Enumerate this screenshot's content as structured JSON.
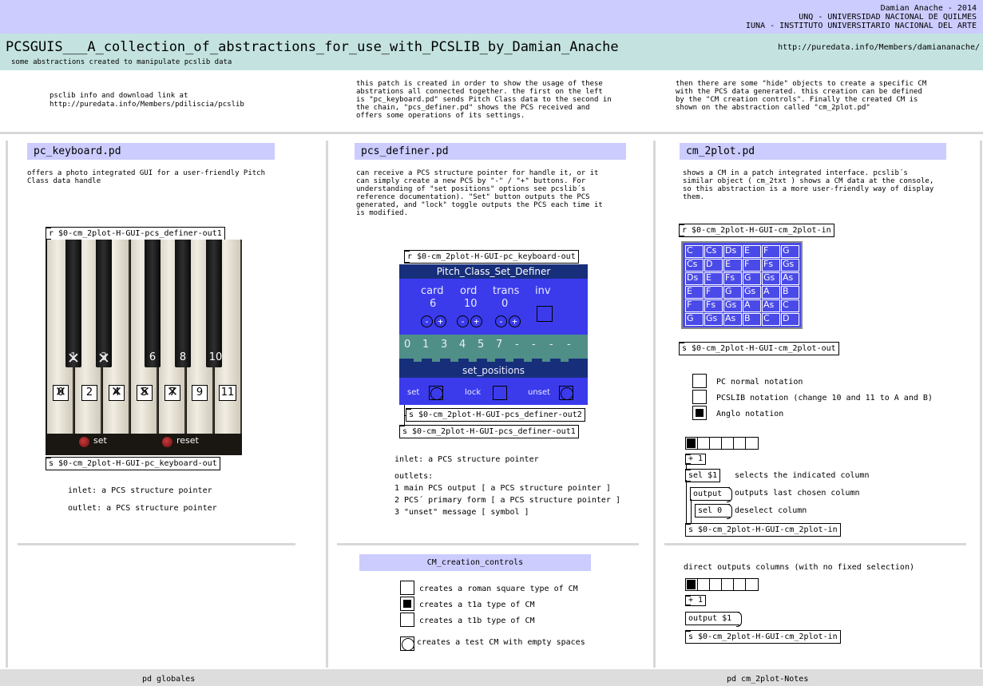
{
  "header": {
    "title": "PCSGUIS___A_collection_of_abstractions_for_use_with_PCSLIB_by_Damian_Anache",
    "subtitle": "some abstractions created to manipulate pcslib data",
    "url": "http://puredata.info/Members/damiananache/",
    "credits_line1": "Damian Anache - 2014",
    "credits_line2": "UNQ - UNIVERSIDAD NACIONAL DE QUILMES",
    "credits_line3": "IUNA - INSTITUTO UNIVERSITARIO NACIONAL DEL ARTE"
  },
  "intro": {
    "col1": "psclib info and download link at\nhttp://puredata.info/Members/pdiliscia/pcslib",
    "col2": "this patch is created in order to show the usage of these\nabstrations all connected together. the first on the left\nis \"pc_keyboard.pd\" sends Pitch Class data to the second in\nthe chain, \"pcs_definer.pd\" shows the PCS received and\noffers some operations of its settings.",
    "col3": "then there are some \"hide\" objects to create a specific CM\nwith the PCS data generated. this creation can be defined\nby the \"CM creation controls\". Finally the created CM is\nshown on the abstraction called \"cm_2plot.pd\""
  },
  "pc_keyboard": {
    "title": "pc_keyboard.pd",
    "desc": "offers a photo integrated GUI for a user-friendly Pitch\nClass data handle",
    "receive": "r $0-cm_2plot-H-GUI-pcs_definer-out1",
    "send": "s $0-cm_2plot-H-GUI-pc_keyboard-out",
    "black_numbers": [
      "1",
      "3",
      "6",
      "8",
      "10"
    ],
    "white_numbers": [
      "0",
      "2",
      "4",
      "5",
      "7",
      "9",
      "11"
    ],
    "set_label": "set",
    "reset_label": "reset",
    "inlet": "inlet: a PCS structure pointer",
    "outlet": "outlet: a PCS structure pointer"
  },
  "pcs_definer": {
    "title": "pcs_definer.pd",
    "desc": "can receive a PCS structure pointer for handle it, or it\ncan simply create a new PCS by \"-\" / \"+\" buttons. For\nunderstanding of \"set positions\" options see pcslib´s\nreference documentation). \"Set\" button outputs the PCS\ngenerated, and \"lock\" toggle outputs the PCS each time it\nis modified.",
    "receive": "r $0-cm_2plot-H-GUI-pc_keyboard-out",
    "gui_title": "Pitch_Class_Set_Definer",
    "card_label": "card",
    "ord_label": "ord",
    "trans_label": "trans",
    "inv_label": "inv",
    "card_value": "6",
    "ord_value": "10",
    "trans_value": "0",
    "minus": "-",
    "plus": "+",
    "positions": [
      "0",
      "1",
      "3",
      "4",
      "5",
      "7",
      "-",
      "-",
      "-",
      "-"
    ],
    "set_positions_label": "set_positions",
    "set_label": "set",
    "lock_label": "lock",
    "unset_label": "unset",
    "send2": "s $0-cm_2plot-H-GUI-pcs_definer-out2",
    "send1": "s $0-cm_2plot-H-GUI-pcs_definer-out1",
    "inlet": "inlet: a PCS structure pointer",
    "outlets_label": "outlets:",
    "outlet1": "1 main PCS output [ a PCS structure pointer ]",
    "outlet2": "2 PCS´ primary form [ a PCS structure pointer ]",
    "outlet3": "3 \"unset\" message [ symbol ]"
  },
  "cm_creation": {
    "title": "CM_creation_controls",
    "opt1": "creates a roman square type of CM",
    "opt2": "creates a t1a type of CM",
    "opt3": "creates a t1b type of CM",
    "opt4": "creates a test CM with empty spaces"
  },
  "cm_2plot": {
    "title": "cm_2plot.pd",
    "desc": "shows a CM in a patch integrated interface. pcslib´s\nsimilar object ( cm_2txt ) shows a CM data at the console,\nso this abstraction is a more user-friendly way of display\nthem.",
    "receive": "r $0-cm_2plot-H-GUI-cm_2plot-in",
    "send_out": "s $0-cm_2plot-H-GUI-cm_2plot-out",
    "grid": [
      [
        "C",
        "Cs",
        "Ds",
        "E",
        "F",
        "G"
      ],
      [
        "Cs",
        "D",
        "E",
        "F",
        "Fs",
        "Gs"
      ],
      [
        "Ds",
        "E",
        "Fs",
        "G",
        "Gs",
        "As"
      ],
      [
        "E",
        "F",
        "G",
        "Gs",
        "A",
        "B"
      ],
      [
        "F",
        "Fs",
        "Gs",
        "A",
        "As",
        "C"
      ],
      [
        "G",
        "Gs",
        "As",
        "B",
        "C",
        "D"
      ]
    ],
    "notation1": "PC normal notation",
    "notation2": "PCSLIB notation (change 10 and 11 to A and B)",
    "notation3": "Anglo notation",
    "plus1": "+ 1",
    "sel1": "sel $1",
    "sel1_comment": "selects the indicated column",
    "output_msg": "output",
    "output_comment": "outputs last chosen column",
    "sel0": "sel 0",
    "sel0_comment": "deselect column",
    "send_in": "s $0-cm_2plot-H-GUI-cm_2plot-in",
    "direct_comment": "direct outputs columns (with no fixed selection)",
    "plus1b": "+ 1",
    "output1_msg": "output $1",
    "send_in2": "s $0-cm_2plot-H-GUI-cm_2plot-in"
  },
  "footer": {
    "left": "pd globales",
    "right": "pd cm_2plot-Notes"
  },
  "colors": {
    "header_bg": "#ccccff",
    "title_bar_bg": "#c4e3e0",
    "gui_blue": "#3b3bec",
    "gui_dark": "#172f7a",
    "gui_teal": "#4f8f88"
  }
}
